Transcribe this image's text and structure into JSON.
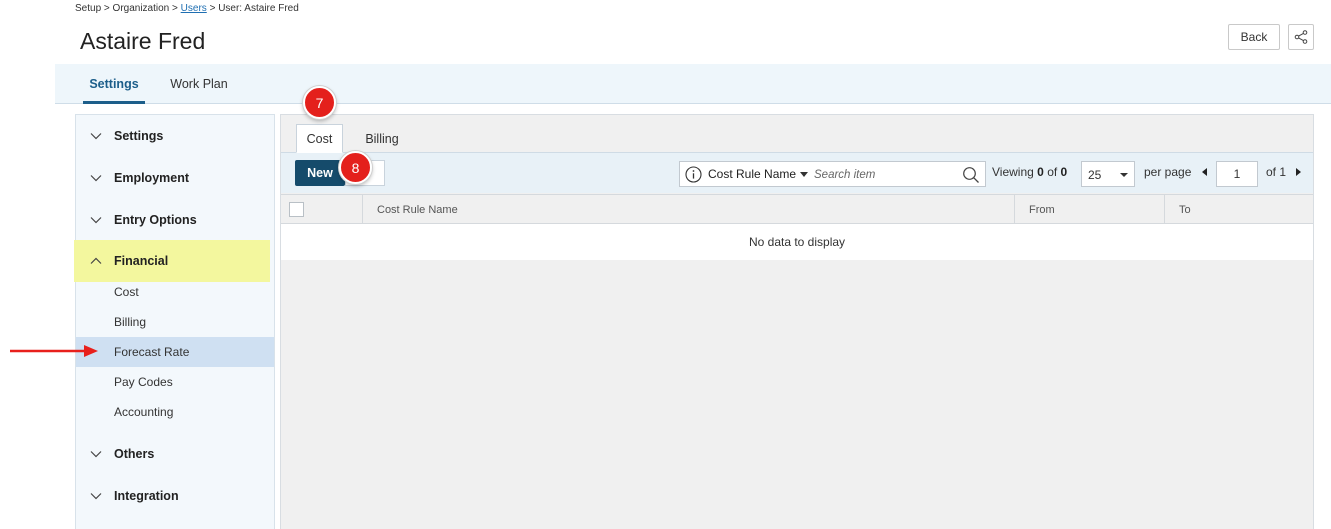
{
  "breadcrumb": {
    "setup": "Setup",
    "sep1": ">",
    "organization": "Organization",
    "sep2": ">",
    "users": "Users",
    "sep3": ">",
    "current": "User: Astaire Fred"
  },
  "header": {
    "title": "Astaire Fred",
    "back_label": "Back",
    "share_icon": "share-icon"
  },
  "top_tabs": [
    {
      "label": "Settings",
      "active": true
    },
    {
      "label": "Work Plan",
      "active": false
    }
  ],
  "sidebar": {
    "sections": [
      {
        "label": "Settings",
        "expanded": false
      },
      {
        "label": "Employment",
        "expanded": false
      },
      {
        "label": "Entry Options",
        "expanded": false
      },
      {
        "label": "Financial",
        "expanded": true,
        "highlight_color": "#f3f79e"
      },
      {
        "label": "Others",
        "expanded": false
      },
      {
        "label": "Integration",
        "expanded": false
      }
    ],
    "financial_items": [
      {
        "label": "Cost"
      },
      {
        "label": "Billing"
      },
      {
        "label": "Forecast Rate",
        "selected": true
      },
      {
        "label": "Pay Codes"
      },
      {
        "label": "Accounting"
      }
    ]
  },
  "sub_tabs": [
    {
      "label": "Cost",
      "active": true
    },
    {
      "label": "Billing",
      "active": false
    }
  ],
  "toolbar": {
    "new_label": "New",
    "search_field_label": "Cost Rule Name",
    "search_placeholder": "Search item",
    "viewing_prefix": "Viewing",
    "viewing_from": "0",
    "viewing_of": "of",
    "viewing_total": "0",
    "per_page_value": "25",
    "per_page_label": "per page",
    "page_number": "1",
    "of_pages": "of 1"
  },
  "grid": {
    "columns": [
      "Cost Rule Name",
      "From",
      "To"
    ],
    "empty_text": "No data to display"
  },
  "callouts": [
    "7",
    "8"
  ],
  "colors": {
    "accent": "#1c5e8a",
    "primary_button": "#154b6b",
    "callout": "#e4201c",
    "arrow": "#e8201c",
    "selected_item": "#cfe0f2"
  }
}
